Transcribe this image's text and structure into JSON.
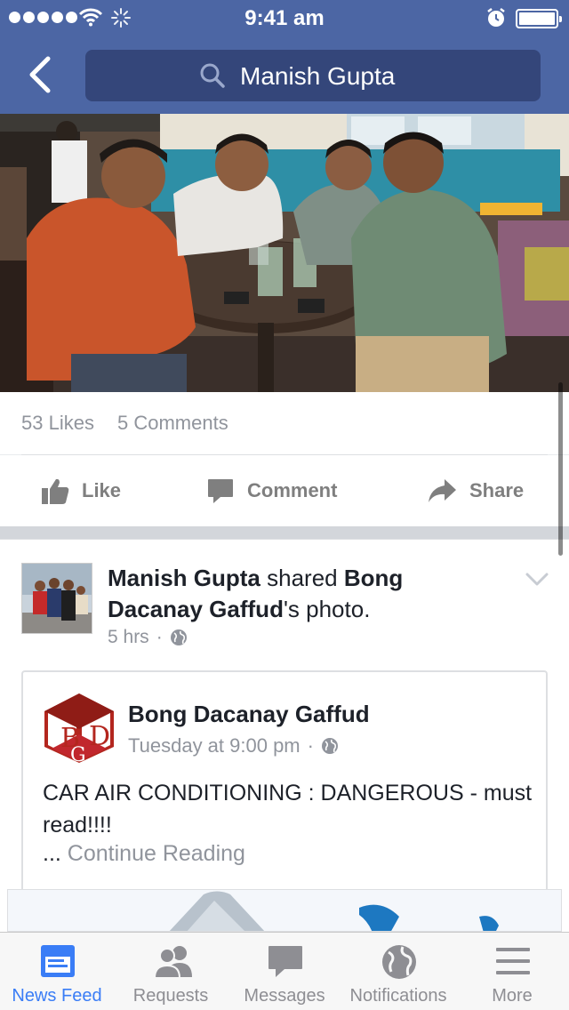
{
  "status_bar": {
    "time": "9:41 am",
    "battery_level": 1.0
  },
  "header": {
    "search_query": "Manish Gupta",
    "back_icon": "chevron-left-icon",
    "search_icon": "search-icon"
  },
  "post1": {
    "likes": "53 Likes",
    "comments": "5 Comments",
    "actions": {
      "like": "Like",
      "comment": "Comment",
      "share": "Share"
    }
  },
  "post2": {
    "author": "Manish Gupta",
    "verb": "shared",
    "shared_from": "Bong Dacanay Gaffud",
    "possessive": "'s photo.",
    "time": "5 hrs",
    "privacy_icon": "globe-icon",
    "shared_post": {
      "name": "Bong Dacanay Gaffud",
      "logo_letters": [
        "B",
        "D",
        "G"
      ],
      "time": "Tuesday at 9:00 pm",
      "text": "CAR AIR CONDITIONING : DANGEROUS - must read!!!!",
      "ellipsis": "...",
      "continue": "Continue Reading"
    }
  },
  "tabs": [
    {
      "label": "News Feed",
      "icon": "news-feed-icon",
      "active": true
    },
    {
      "label": "Requests",
      "icon": "friend-requests-icon",
      "active": false
    },
    {
      "label": "Messages",
      "icon": "messages-icon",
      "active": false
    },
    {
      "label": "Notifications",
      "icon": "globe-notifications-icon",
      "active": false
    },
    {
      "label": "More",
      "icon": "menu-icon",
      "active": false
    }
  ],
  "colors": {
    "brand": "#4c66a4",
    "search_bg": "#34467a",
    "active_tab": "#3a7df6",
    "muted": "#90949c"
  }
}
